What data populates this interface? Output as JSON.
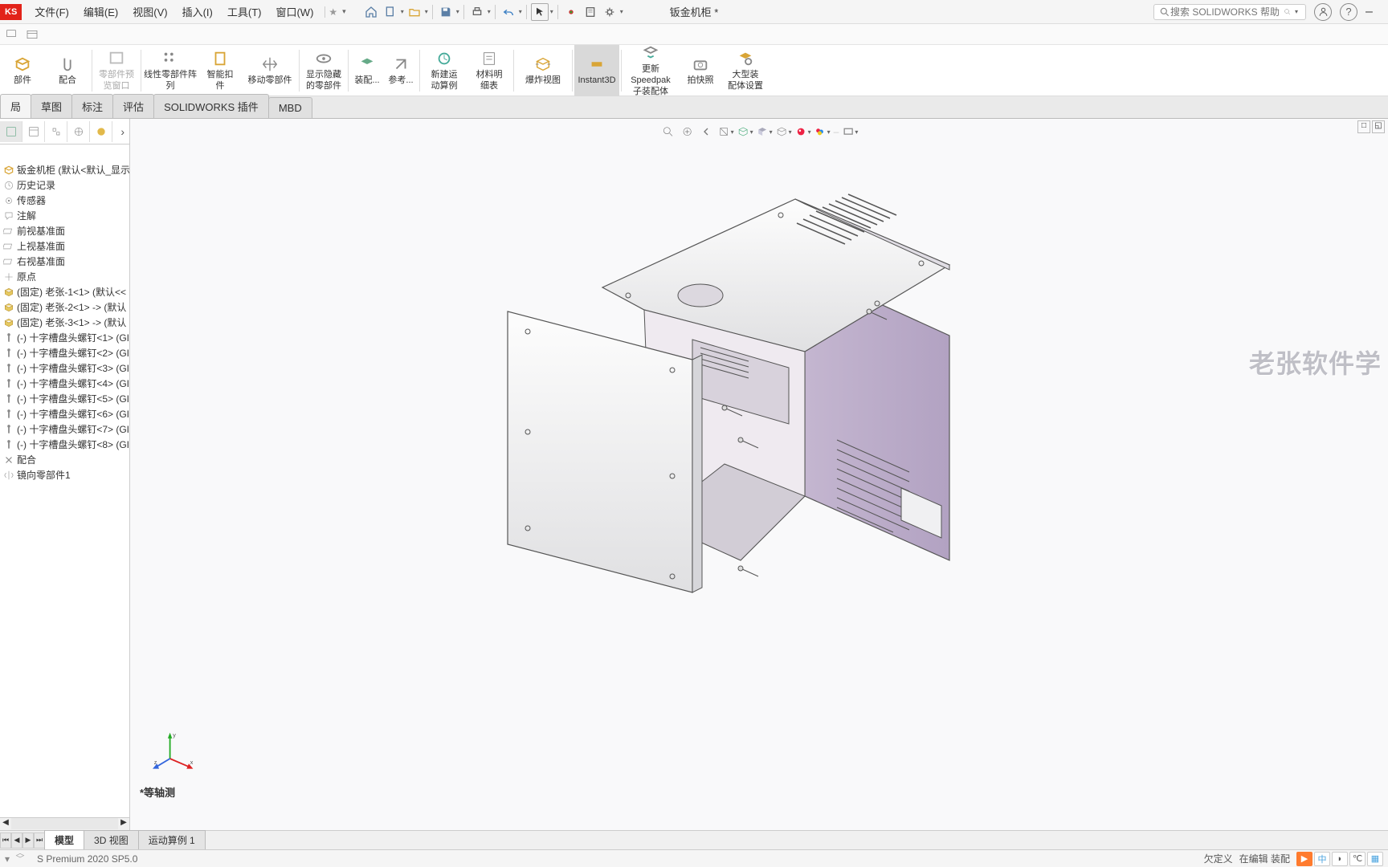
{
  "logo": "KS",
  "menu": [
    "文件(F)",
    "编辑(E)",
    "视图(V)",
    "插入(I)",
    "工具(T)",
    "窗口(W)"
  ],
  "star": "★",
  "docTitle": "钣金机柜 *",
  "search": {
    "placeholder": "搜索 SOLIDWORKS 帮助"
  },
  "ribbon": [
    {
      "label": "部件",
      "icon": "cube"
    },
    {
      "label": "配合",
      "icon": "clip"
    },
    {
      "label": "零部件预\n览窗口",
      "icon": "win",
      "dis": true
    },
    {
      "label": "线性零部件阵列",
      "icon": "array",
      "wide": true
    },
    {
      "label": "智能扣\n件",
      "icon": "smart"
    },
    {
      "label": "移动零部件",
      "icon": "move",
      "wide": true
    },
    {
      "label": "显示隐藏\n的零部件",
      "icon": "eye"
    },
    {
      "label": "装配...",
      "icon": "asm",
      "narrow": true
    },
    {
      "label": "参考...",
      "icon": "ref",
      "narrow": true
    },
    {
      "label": "新建运\n动算例",
      "icon": "motion"
    },
    {
      "label": "材料明\n细表",
      "icon": "bom"
    },
    {
      "label": "爆炸视图",
      "icon": "explode",
      "wide": true
    },
    {
      "label": "Instant3D",
      "icon": "instant",
      "active": true
    },
    {
      "label": "更新 Speedpak\n子装配体",
      "icon": "speed",
      "wide": true
    },
    {
      "label": "拍快照",
      "icon": "cam"
    },
    {
      "label": "大型装\n配体设置",
      "icon": "large"
    }
  ],
  "tabs": [
    "局",
    "草图",
    "标注",
    "评估",
    "SOLIDWORKS 插件",
    "MBD"
  ],
  "tree": [
    {
      "t": "钣金机柜 (默认<默认_显示状",
      "i": "asm"
    },
    {
      "t": "历史记录",
      "i": "hist"
    },
    {
      "t": "传感器",
      "i": "sensor"
    },
    {
      "t": "注解",
      "i": "annot"
    },
    {
      "t": "前视基准面",
      "i": "plane"
    },
    {
      "t": "上视基准面",
      "i": "plane"
    },
    {
      "t": "右视基准面",
      "i": "plane"
    },
    {
      "t": "原点",
      "i": "origin"
    },
    {
      "t": "(固定) 老张-1<1> (默认<<",
      "i": "yellow"
    },
    {
      "t": "(固定) 老张-2<1> -> (默认",
      "i": "yellow"
    },
    {
      "t": "(固定) 老张-3<1> -> (默认",
      "i": "yellow"
    },
    {
      "t": "(-) 十字槽盘头螺钉<1> (GI",
      "i": "screw"
    },
    {
      "t": "(-) 十字槽盘头螺钉<2> (GI",
      "i": "screw"
    },
    {
      "t": "(-) 十字槽盘头螺钉<3> (GI",
      "i": "screw"
    },
    {
      "t": "(-) 十字槽盘头螺钉<4> (GI",
      "i": "screw"
    },
    {
      "t": "(-) 十字槽盘头螺钉<5> (GI",
      "i": "screw"
    },
    {
      "t": "(-) 十字槽盘头螺钉<6> (GI",
      "i": "screw"
    },
    {
      "t": "(-) 十字槽盘头螺钉<7> (GI",
      "i": "screw"
    },
    {
      "t": "(-) 十字槽盘头螺钉<8> (GI",
      "i": "screw"
    },
    {
      "t": "配合",
      "i": "mate"
    },
    {
      "t": "镜向零部件1",
      "i": "mirror"
    }
  ],
  "viewLabel": "*等轴测",
  "watermark": "老张软件学",
  "bottomTabs": [
    "模型",
    "3D 视图",
    "运动算例 1"
  ],
  "status": {
    "version": "S Premium 2020 SP5.0",
    "r1": "欠定义",
    "r2": "在编辑 装配"
  },
  "tray": [
    "▶",
    "中",
    "◗",
    "℃",
    "▦"
  ]
}
